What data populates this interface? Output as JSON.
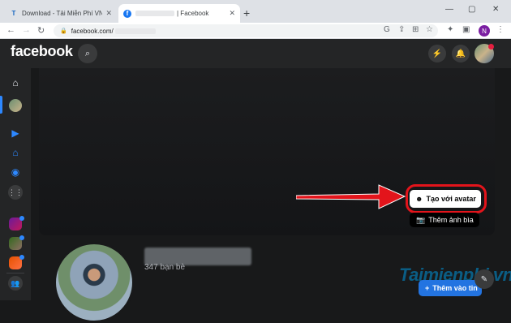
{
  "browser": {
    "tabs": [
      {
        "favicon": "T",
        "title": "Download - Tải Miễn Phí VN - Ph",
        "active": false
      },
      {
        "favicon": "f",
        "title": "| Facebook",
        "active": true
      }
    ],
    "new_tab": "+",
    "window_controls": [
      "—",
      "▢",
      "✕"
    ],
    "url": "facebook.com/",
    "nav": {
      "back": "←",
      "forward": "→",
      "reload": "↻"
    },
    "profile_initial": "N",
    "toolbar_icons": [
      "google-icon",
      "share-icon",
      "install-icon",
      "star-icon",
      "extensions-icon",
      "side-panel-icon"
    ]
  },
  "facebook": {
    "logo": "facebook",
    "header_buttons": [
      "messenger-icon",
      "bell-icon"
    ],
    "left_rail": [
      "home-icon",
      "profile-icon",
      "watch-icon",
      "marketplace-icon",
      "gaming-icon",
      "menu-grid-icon",
      "group-1-icon",
      "group-2-icon",
      "group-3-icon",
      "friends-icon"
    ]
  },
  "cover": {
    "avatar_button": "Tạo với avatar",
    "cover_button": "Thêm ảnh bìa"
  },
  "profile": {
    "friends_count": "347 bạn bè",
    "story_button": "Thêm vào tin"
  },
  "watermark": "Taimienphi.vn",
  "colors": {
    "accent": "#2374e1",
    "highlight": "#e3141b",
    "background": "#18191a"
  }
}
